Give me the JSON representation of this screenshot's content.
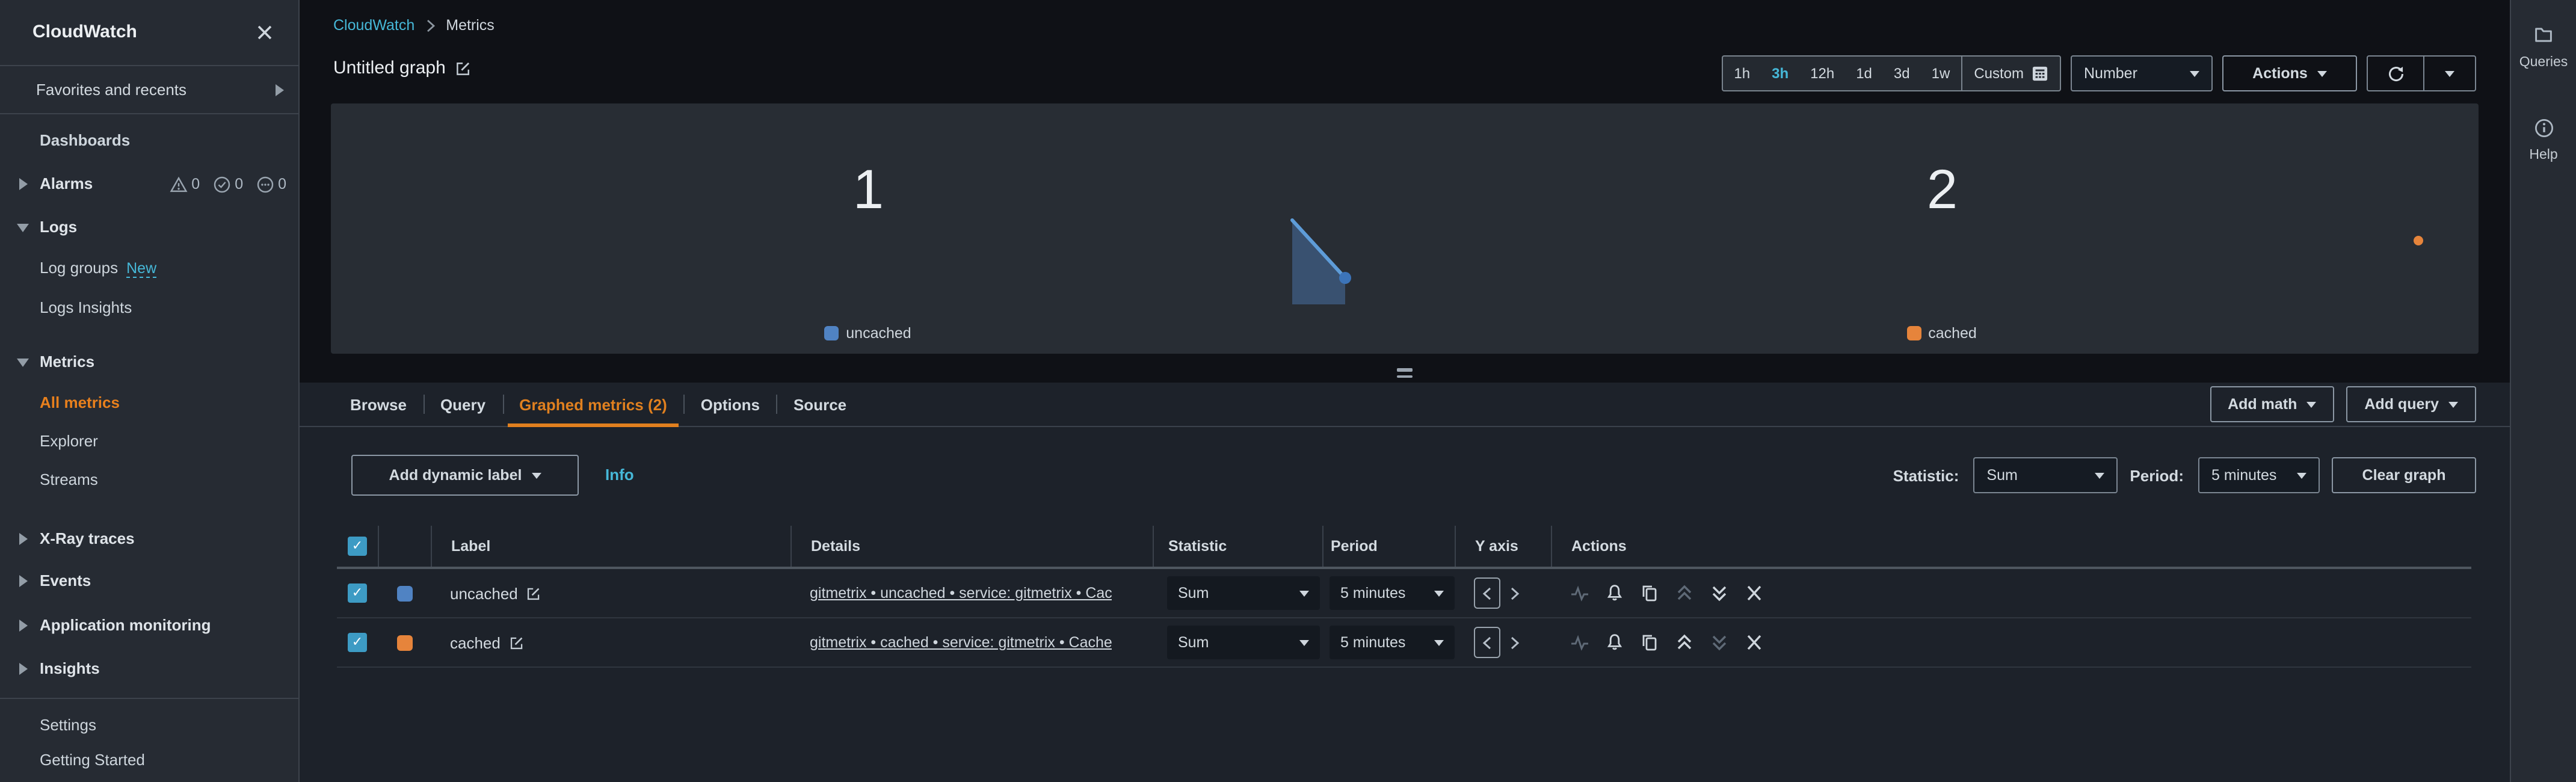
{
  "sidebar": {
    "title": "CloudWatch",
    "favorites": "Favorites and recents",
    "dashboards": "Dashboards",
    "alarms": "Alarms",
    "alarm_counts": {
      "in_alarm": "0",
      "ok": "0",
      "insufficient": "0"
    },
    "logs": "Logs",
    "log_groups": "Log groups",
    "log_groups_badge": "New",
    "logs_insights": "Logs Insights",
    "metrics": "Metrics",
    "all_metrics": "All metrics",
    "explorer": "Explorer",
    "streams": "Streams",
    "xray": "X-Ray traces",
    "events": "Events",
    "app_monitoring": "Application monitoring",
    "insights": "Insights",
    "settings": "Settings",
    "getting_started": "Getting Started"
  },
  "header": {
    "breadcrumb_root": "CloudWatch",
    "breadcrumb_current": "Metrics",
    "graph_title": "Untitled graph"
  },
  "time_controls": {
    "ranges": [
      "1h",
      "3h",
      "12h",
      "1d",
      "3d",
      "1w"
    ],
    "selected": "3h",
    "custom": "Custom",
    "view_select": "Number",
    "actions": "Actions"
  },
  "rail": {
    "queries": "Queries",
    "help": "Help"
  },
  "graph": {
    "left": {
      "value": "1",
      "legend": "uncached",
      "color": "#5083c3"
    },
    "right": {
      "value": "2",
      "legend": "cached",
      "color": "#e6843b"
    }
  },
  "tabs": {
    "browse": "Browse",
    "query": "Query",
    "graphed": "Graphed metrics (2)",
    "options": "Options",
    "source": "Source",
    "add_math": "Add math",
    "add_query": "Add query"
  },
  "toolbar": {
    "add_dynamic_label": "Add dynamic label",
    "info": "Info",
    "statistic_label": "Statistic:",
    "statistic_value": "Sum",
    "period_label": "Period:",
    "period_value": "5 minutes",
    "clear": "Clear graph"
  },
  "table": {
    "headers": {
      "label": "Label",
      "details": "Details",
      "statistic": "Statistic",
      "period": "Period",
      "yaxis": "Y axis",
      "actions": "Actions"
    },
    "rows": [
      {
        "label": "uncached",
        "details": "gitmetrix • uncached • service: gitmetrix • Cac",
        "statistic": "Sum",
        "period": "5 minutes",
        "color": "#5083c3"
      },
      {
        "label": "cached",
        "details": "gitmetrix • cached • service: gitmetrix • Cache",
        "statistic": "Sum",
        "period": "5 minutes",
        "color": "#e6843b"
      }
    ]
  },
  "colors": {
    "link_blue": "#46b8d8",
    "accent_orange": "#e0801f",
    "series_blue": "#5083c3",
    "series_orange": "#e6843b",
    "checkbox_blue": "#3d9bc4"
  }
}
